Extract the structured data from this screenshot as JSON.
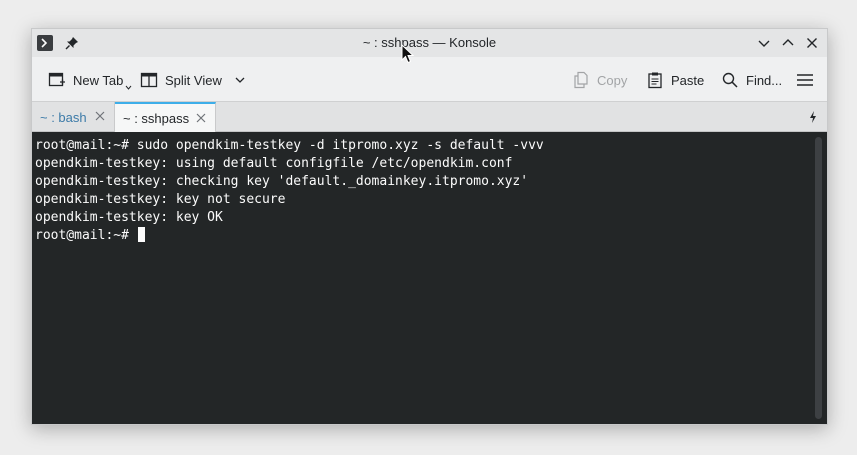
{
  "window": {
    "title": "~ : sshpass — Konsole",
    "app_icon": "konsole-icon",
    "pin_icon": "pin-icon"
  },
  "toolbar": {
    "new_tab": "New Tab",
    "split_view": "Split View",
    "copy": "Copy",
    "paste": "Paste",
    "find": "Find...",
    "menu_icon": "hamburger-icon"
  },
  "tabs": [
    {
      "label": "~ : bash",
      "active": false
    },
    {
      "label": "~ : sshpass",
      "active": true
    }
  ],
  "terminal": {
    "lines": [
      "root@mail:~# sudo opendkim-testkey -d itpromo.xyz -s default -vvv",
      "opendkim-testkey: using default configfile /etc/opendkim.conf",
      "opendkim-testkey: checking key 'default._domainkey.itpromo.xyz'",
      "opendkim-testkey: key not secure",
      "opendkim-testkey: key OK"
    ],
    "prompt": "root@mail:~# "
  },
  "colors": {
    "terminal_bg": "#232627",
    "terminal_fg": "#fcfcfc",
    "accent": "#3daee9",
    "inactive_tab_text": "#3d7ba8"
  }
}
